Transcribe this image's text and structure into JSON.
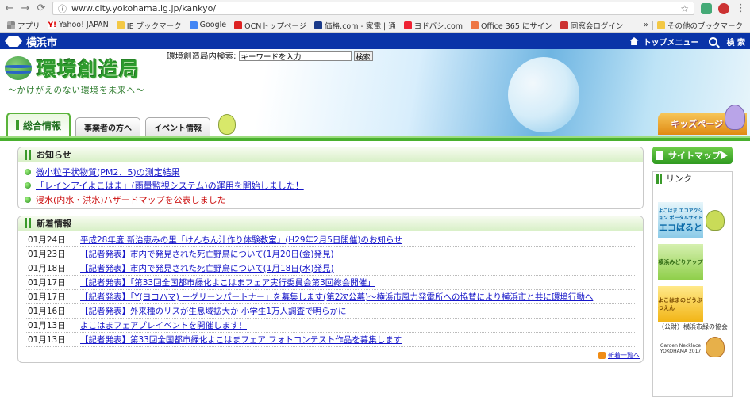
{
  "browser": {
    "url": "www.city.yokohama.lg.jp/kankyo/",
    "bookmarks": [
      "アプリ",
      "Yahoo! JAPAN",
      "IE ブックマーク",
      "Google",
      "OCNトップページ",
      "価格.com - 家電 | 通",
      "ヨドバシ.com",
      "Office 365 にサイン",
      "同窓会ログイン"
    ],
    "bookmarks_more": "»",
    "other_bookmarks": "その他のブックマーク"
  },
  "site": {
    "city": "横浜市",
    "top_menu": "トップメニュー",
    "search_label": "検 索"
  },
  "header": {
    "title": "環境創造局",
    "tagline": "～かけがえのない環境を未来へ～",
    "search_prefix": "環境創造局内検索:",
    "search_placeholder": "キーワードを入力",
    "search_button": "検索",
    "kids_page": "キッズページ"
  },
  "tabs": [
    {
      "label": "総合情報"
    },
    {
      "label": "事業者の方へ"
    },
    {
      "label": "イベント情報"
    }
  ],
  "notices": {
    "title": "お知らせ",
    "items": [
      {
        "text": "微小粒子状物質(PM2．5)の測定結果"
      },
      {
        "text": "「レインアイよこはま」(雨量監視システム)の運用を開始しました！"
      },
      {
        "text": "浸水(内水・洪水)ハザードマップを公表しました"
      }
    ]
  },
  "news": {
    "title": "新着情報",
    "items": [
      {
        "date": "01月24日",
        "text": "平成28年度 新治恵みの里「けんちん汁作り体験教室」(H29年2月5日開催)のお知らせ"
      },
      {
        "date": "01月23日",
        "text": "【記者発表】市内で発見された死亡野鳥について(1月20日(金)発見)"
      },
      {
        "date": "01月18日",
        "text": "【記者発表】市内で発見された死亡野鳥について(1月18日(水)発見)"
      },
      {
        "date": "01月17日",
        "text": "【記者発表】「第33回全国都市緑化よこはまフェア実行委員会第3回総会開催」"
      },
      {
        "date": "01月17日",
        "text": "【記者発表】「Y(ヨコハマ) －グリーンパートナー」を募集します(第2次公募)～横浜市風力発電所への協賛により横浜市と共に環境行動へ"
      },
      {
        "date": "01月16日",
        "text": "【記者発表】外来種のリスが生息域拡大か 小学生1万人調査で明らかに"
      },
      {
        "date": "01月13日",
        "text": "よこはまフェアプレイベントを開催します！"
      },
      {
        "date": "01月13日",
        "text": "【記者発表】第33回全国都市緑化よこはまフェア フォトコンテスト作品を募集します"
      }
    ],
    "more": "新着一覧へ"
  },
  "sidebar": {
    "sitemap": "サイトマップ",
    "links_title": "リンク",
    "banners": {
      "eco_small": "よこはま エコアクション ポータルサイト",
      "eco_big": "エコぱると",
      "midori": "横浜みどりアップ",
      "zoo": "よこはまのどうぶつえん",
      "zoo_assoc": "（公財）横浜市緑の協会",
      "necklace": "Garden Necklace YOKOHAMA 2017"
    }
  }
}
